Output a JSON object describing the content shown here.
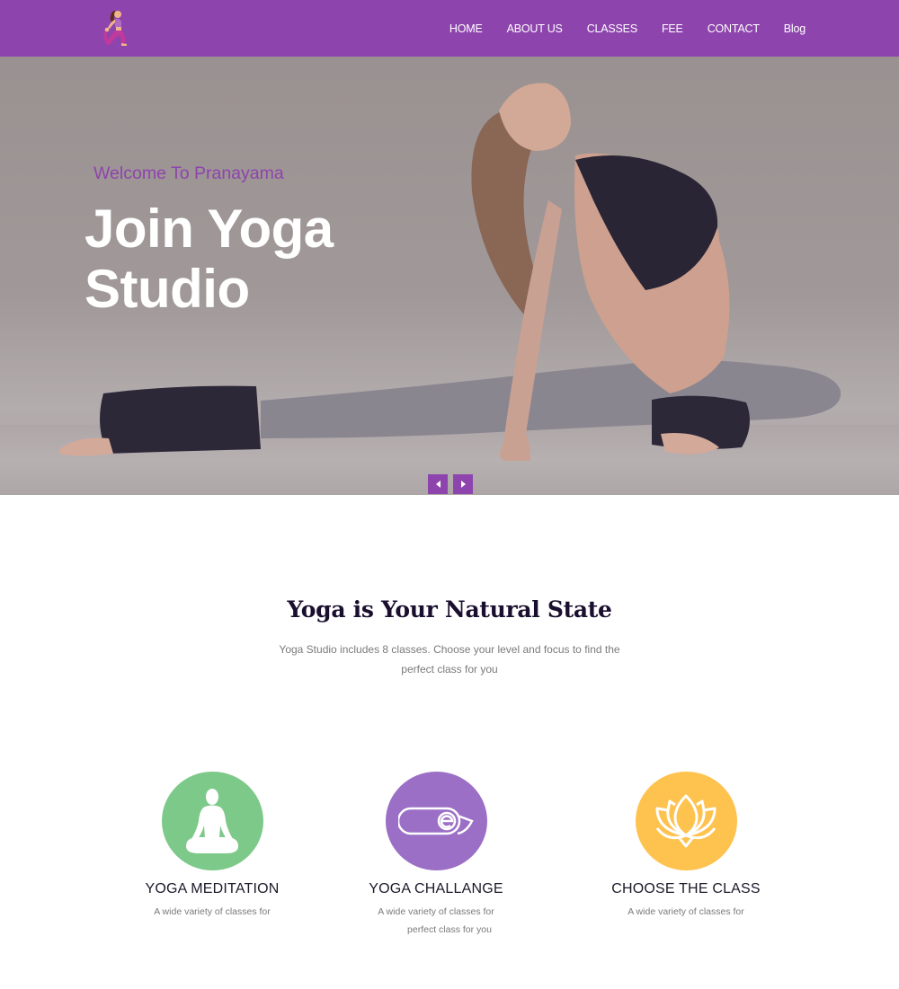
{
  "header": {
    "logo": "yoga-pose-logo",
    "nav": [
      {
        "label": "HOME"
      },
      {
        "label": "ABOUT US"
      },
      {
        "label": "CLASSES"
      },
      {
        "label": "FEE"
      },
      {
        "label": "CONTACT"
      },
      {
        "label": "Blog"
      }
    ]
  },
  "hero": {
    "welcome": "Welcome To Pranayama",
    "title_line1": "Join Yoga",
    "title_line2": "Studio",
    "prev_icon": "chevron-left",
    "next_icon": "chevron-right"
  },
  "intro": {
    "title": "Yoga is Your Natural State",
    "text_line1": "Yoga Studio includes 8 classes. Choose your level and focus to find the",
    "text_line2": "perfect class for you"
  },
  "features": [
    {
      "icon": "meditation-icon",
      "color": "#7dc98a",
      "title": "YOGA MEDITATION",
      "text_line1": "A wide variety of classes for",
      "text_line2": ""
    },
    {
      "icon": "yoga-mat-icon",
      "color": "#9b6fc5",
      "title": "YOGA CHALLANGE",
      "text_line1": "A wide variety of classes for",
      "text_line2": "perfect class for you"
    },
    {
      "icon": "lotus-icon",
      "color": "#fec24f",
      "title": "CHOOSE THE CLASS",
      "text_line1": "A wide variety of classes for",
      "text_line2": ""
    }
  ],
  "colors": {
    "brand": "#8e44ad",
    "heading": "#1a0f2e",
    "muted_text": "#7a7a7a"
  }
}
